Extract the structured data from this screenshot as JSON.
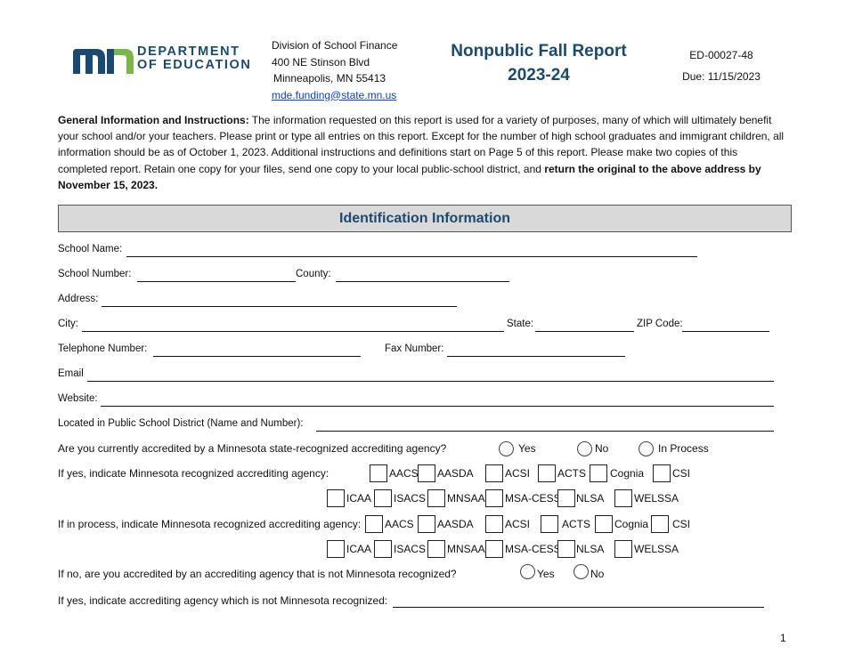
{
  "header": {
    "logo": {
      "line1": "DEPARTMENT",
      "line2": "OF EDUCATION",
      "colors": {
        "blue": "#1a4a72",
        "green": "#7ab648"
      }
    },
    "address": {
      "division": "Division of School Finance",
      "street": "400 NE Stinson Blvd",
      "city": "Minneapolis, MN  55413",
      "email": "mde.funding@state.mn.us"
    },
    "title_line1": "Nonpublic Fall Report",
    "title_line2": "2023-24",
    "form_number": "ED-00027-48",
    "due": "Due: 11/15/2023"
  },
  "instructions": {
    "heading": "General Information and Instructions:",
    "body": " The information requested on this report is used for a variety of purposes, many of which will ultimately benefit your school and/or your teachers. Please print or type all entries on this report. Except for the number of high school graduates and immigrant children, all information should be as of October 1, 2023. Additional instructions and definitions start on Page 5 of this report. Please make two copies of this completed report. Retain one copy for your files, send one copy to your local public-school district, and ",
    "bold_tail": "return the original to the above address by November 15, 2023."
  },
  "section_title": "Identification Information",
  "fields": {
    "school_name": "School Name:",
    "school_number": "School Number:",
    "county": "County:",
    "address": "Address:",
    "city": "City:",
    "state": "State:",
    "zip": "ZIP Code:",
    "telephone": "Telephone Number:",
    "fax": "Fax Number:",
    "email": "Email",
    "website": "Website:",
    "district": "Located in Public School District (Name and Number):"
  },
  "accreditation": {
    "q1": "Are you currently accredited by a Minnesota state-recognized accrediting agency?",
    "q1_options": [
      "Yes",
      "No",
      "In Process"
    ],
    "q2": "If yes, indicate Minnesota recognized accrediting agency:",
    "q3": "If in process, indicate Minnesota recognized accrediting agency:",
    "agencies_row1": [
      "AACS",
      "AASDA",
      "ACSI",
      "ACTS",
      "Cognia",
      "CSI"
    ],
    "agencies_row2": [
      "ICAA",
      "ISACS",
      "MNSAA",
      "MSA-CESS",
      "NLSA",
      "WELSSA"
    ],
    "q4": "If no, are you accredited by an accrediting agency that is not Minnesota recognized?",
    "q4_options": [
      "Yes",
      "No"
    ],
    "q5": "If yes, indicate accrediting agency which is not Minnesota recognized:"
  },
  "page_number": "1"
}
